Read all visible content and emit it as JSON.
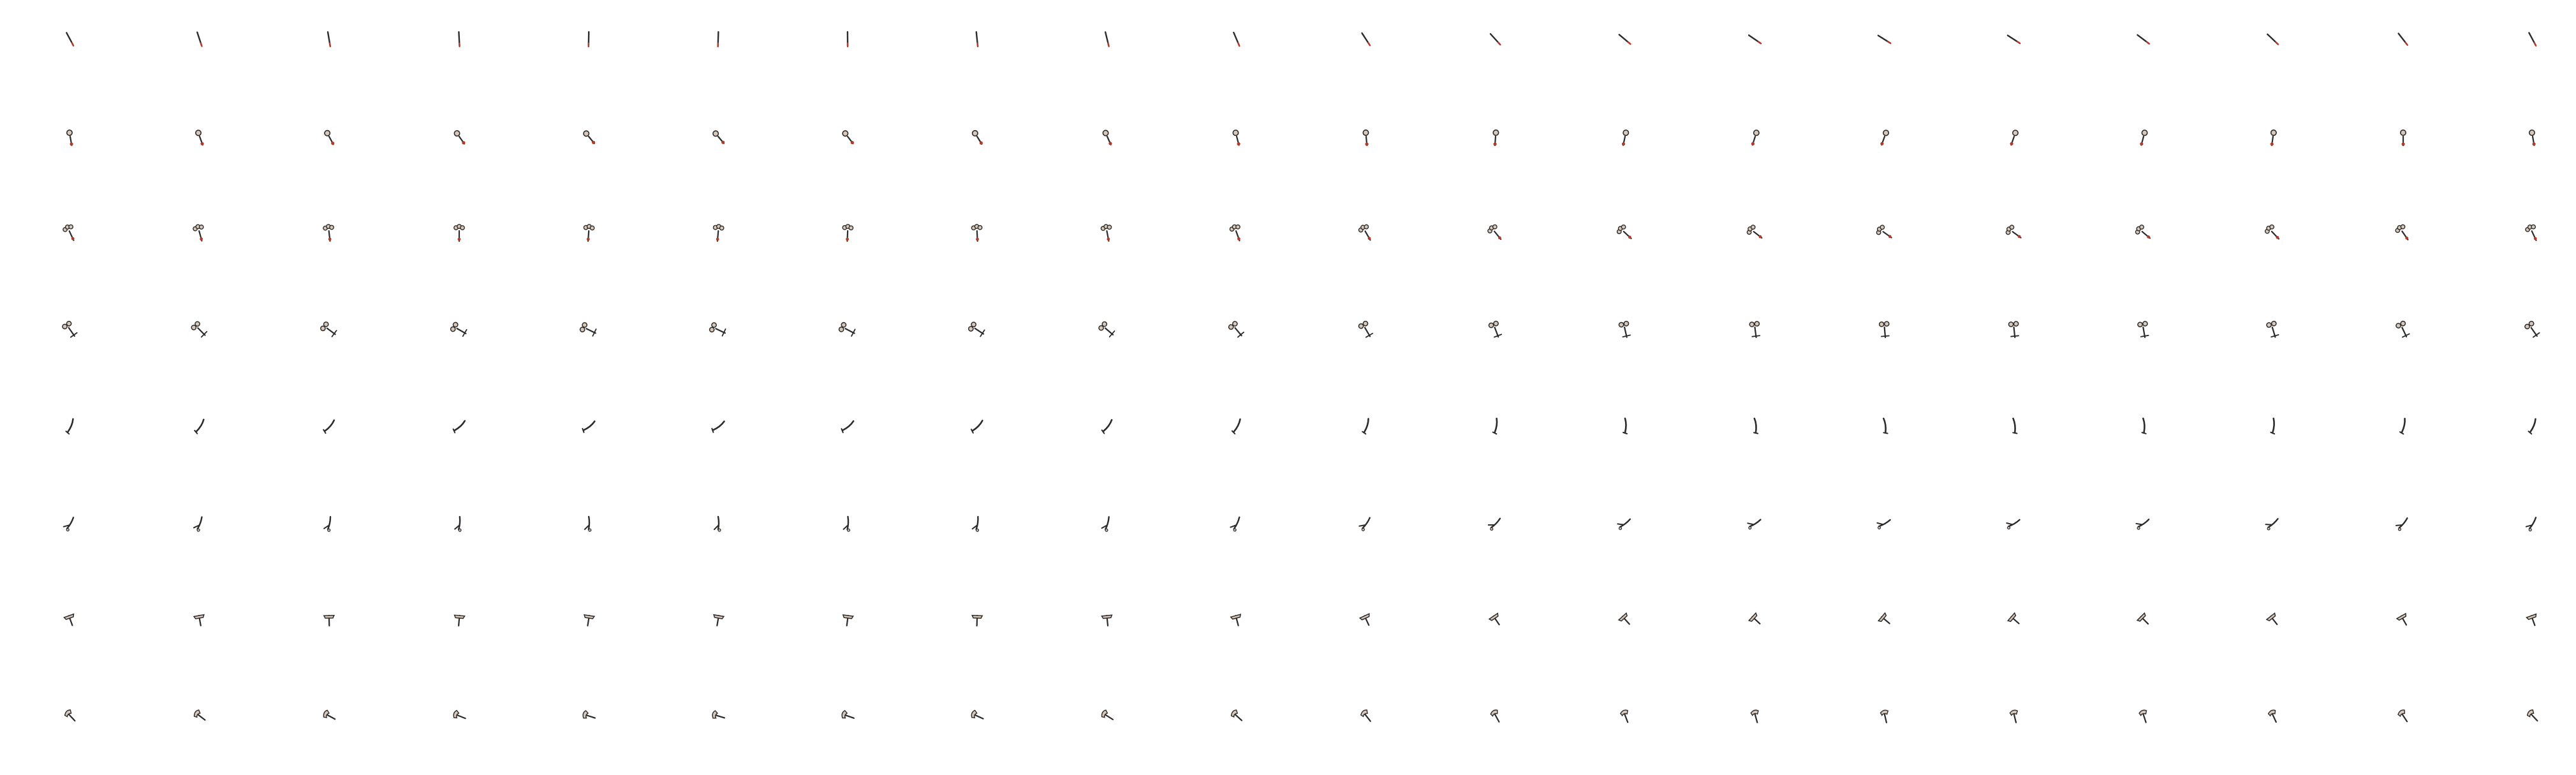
{
  "sheet": {
    "background": "#ffffff",
    "rows": [
      {
        "name": "row-1",
        "kind": "stick",
        "frames": 20
      },
      {
        "name": "row-2",
        "kind": "lollipop",
        "frames": 20
      },
      {
        "name": "row-3",
        "kind": "flower",
        "frames": 20
      },
      {
        "name": "row-4",
        "kind": "flower-tilted",
        "frames": 20
      },
      {
        "name": "row-5",
        "kind": "blade",
        "frames": 20
      },
      {
        "name": "row-6",
        "kind": "blade-branch",
        "frames": 20
      },
      {
        "name": "row-7",
        "kind": "tee",
        "frames": 20
      },
      {
        "name": "row-8",
        "kind": "hook",
        "frames": 20
      }
    ],
    "colors": {
      "ink": "#2b2b2b",
      "accent": "#b23a2a",
      "light": "#d9c7b8"
    }
  }
}
